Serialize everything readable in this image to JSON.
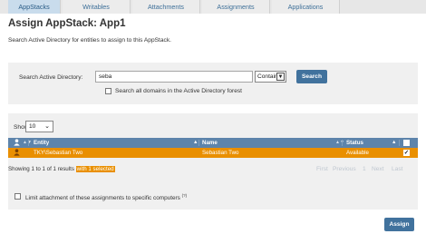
{
  "tabs": [
    {
      "label": "AppStacks",
      "active": true
    },
    {
      "label": "Writables",
      "active": false
    },
    {
      "label": "Attachments",
      "active": false
    },
    {
      "label": "Assignments",
      "active": false
    },
    {
      "label": "Applications",
      "active": false
    }
  ],
  "page": {
    "title": "Assign AppStack: App1",
    "subtitle": "Search Active Directory for entities to assign to this AppStack."
  },
  "search": {
    "label": "Search Active Directory:",
    "value": "seba",
    "mode": "Contains",
    "button": "Search",
    "all_domains_label": "Search all domains in the Active Directory forest",
    "all_domains_checked": false
  },
  "results": {
    "show_label": "Show",
    "page_size": "10",
    "columns": {
      "entity": "Entity",
      "name": "Name",
      "status": "Status"
    },
    "rows": [
      {
        "entity": "TKY\\Sebastian Two",
        "name": "Sebastian Two",
        "status": "Available",
        "selected": true
      }
    ],
    "info_prefix": "Showing 1 to 1 of 1 results",
    "info_selected": "with 1 selected",
    "pager": {
      "first": "First",
      "previous": "Previous",
      "page": "1",
      "next": "Next",
      "last": "Last"
    },
    "limit_label": "Limit attachment of these assignments to specific computers",
    "limit_sup": "(?)",
    "limit_checked": false
  },
  "actions": {
    "assign": "Assign"
  },
  "colors": {
    "accent": "#41729d",
    "header": "#5d84ab",
    "selected_row": "#e98f00",
    "panel": "#f0f0f0"
  }
}
